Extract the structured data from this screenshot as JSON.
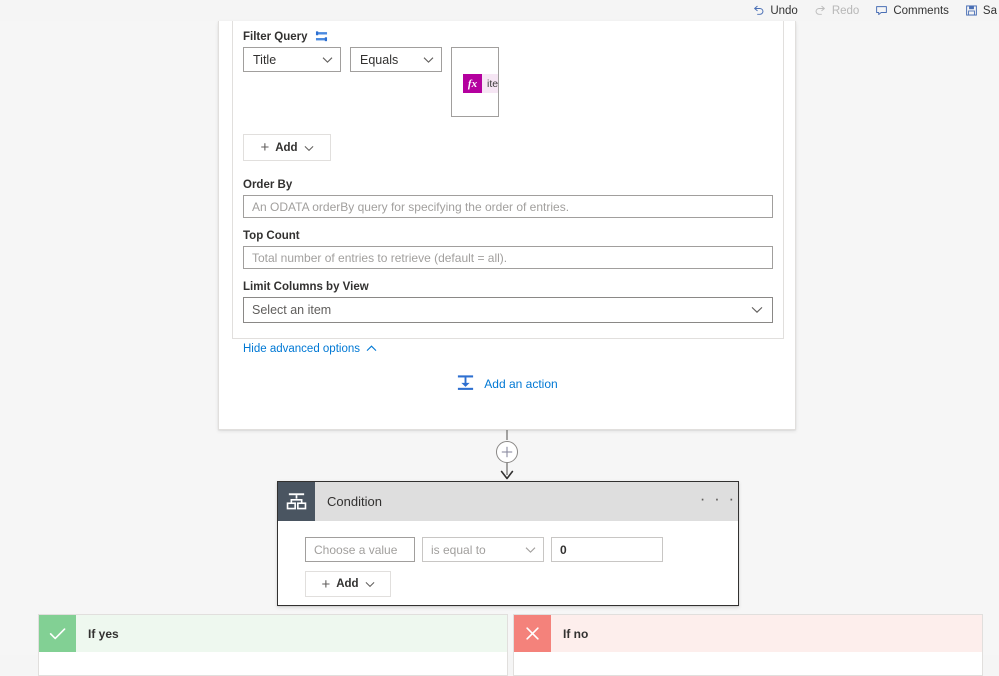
{
  "topbar": {
    "items": [
      {
        "label": "Undo",
        "icon": "undo-icon",
        "disabled": false
      },
      {
        "label": "Redo",
        "icon": "redo-icon",
        "disabled": true
      },
      {
        "label": "Comments",
        "icon": "comment-icon",
        "disabled": false
      },
      {
        "label": "Sa",
        "icon": "save-icon",
        "disabled": false
      }
    ]
  },
  "action_card": {
    "filter_query": {
      "label": "Filter Query",
      "swap_icon": "switch-to-advanced-mode-icon",
      "column_dropdown": {
        "value": "Title",
        "chevron": "chevron-down-icon"
      },
      "operator_dropdown": {
        "value": "Equals",
        "chevron": "chevron-down-icon"
      },
      "token": {
        "icon_label": "fx",
        "text": "ite",
        "icon": "expression-fx-icon"
      }
    },
    "add_row_button": {
      "label": "Add",
      "plus": "+",
      "chevron": "chevron-down-icon"
    },
    "order_by": {
      "label": "Order By",
      "value": "",
      "placeholder": "An ODATA orderBy query for specifying the order of entries."
    },
    "top_count": {
      "label": "Top Count",
      "value": "",
      "placeholder": "Total number of entries to retrieve (default = all)."
    },
    "limit_columns": {
      "label": "Limit Columns by View",
      "value": "Select an item",
      "chevron": "chevron-down-icon"
    },
    "hide_advanced": {
      "label": "Hide advanced options",
      "chevron": "chevron-up-icon"
    },
    "add_action": {
      "label": "Add an action",
      "icon": "add-action-icon"
    }
  },
  "connector": {
    "insert_icon": "add-step-plus-icon",
    "arrow_icon": "arrow-down-icon"
  },
  "condition_card": {
    "title": "Condition",
    "icon": "condition-branch-icon",
    "menu": "· · ·",
    "row": {
      "left_value": {
        "value": "",
        "placeholder": "Choose a value"
      },
      "operator": {
        "value": "is equal to",
        "chevron": "chevron-down-icon"
      },
      "right_value": {
        "value": "0",
        "placeholder": ""
      }
    },
    "add_button": {
      "label": "Add",
      "plus": "+",
      "chevron": "chevron-down-icon"
    }
  },
  "branches": {
    "yes": {
      "label": "If yes",
      "icon": "check-icon"
    },
    "no": {
      "label": "If no",
      "icon": "close-x-icon"
    }
  },
  "colors": {
    "accent_blue": "#0078d4",
    "token_magenta": "#b4009e",
    "token_chip": "#f6e6f4",
    "condition_tile": "#4a5561",
    "yes_tile": "#82d094",
    "yes_bg": "#eef8ef",
    "no_tile": "#f4827b",
    "no_bg": "#fdeeec",
    "canvas_bg": "#f6f6f6"
  }
}
